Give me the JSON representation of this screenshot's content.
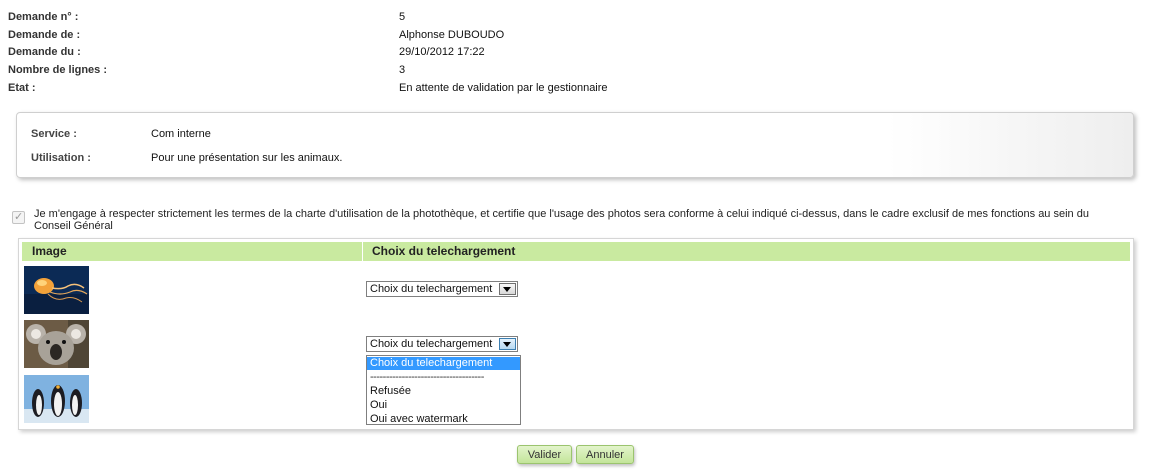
{
  "request": {
    "number_label": "Demande n° :",
    "number_value": "5",
    "from_label": "Demande de :",
    "from_value": "Alphonse DUBOUDO",
    "date_label": "Demande du :",
    "date_value": "29/10/2012 17:22",
    "lines_label": "Nombre de lignes :",
    "lines_value": "3",
    "state_label": "Etat :",
    "state_value": "En attente de validation par le gestionnaire"
  },
  "service_box": {
    "service_label": "Service :",
    "service_value": "Com interne",
    "usage_label": "Utilisation :",
    "usage_value": "Pour une présentation sur les animaux."
  },
  "engagement": {
    "checked": true,
    "text": "Je m'engage à respecter strictement les termes de la charte d'utilisation de la photothèque, et certifie que l'usage des photos sera conforme à celui indiqué ci-dessus, dans le cadre exclusif de mes fonctions au sein du Conseil Général"
  },
  "table": {
    "headers": [
      "Image",
      "Choix du telechargement"
    ],
    "header_color": "#c9eaa0",
    "rows": [
      {
        "image": "jellyfish",
        "select_value": "Choix du telechargement"
      },
      {
        "image": "koala",
        "select_value": "Choix du telechargement"
      },
      {
        "image": "penguins",
        "select_value": ""
      }
    ]
  },
  "dropdown": {
    "options": [
      "Choix du telechargement",
      "------------------------------------",
      "Refusée",
      "Oui",
      "Oui avec watermark"
    ],
    "highlighted": "Choix du telechargement",
    "highlight_color": "#3399ff"
  },
  "buttons": {
    "validate": "Valider",
    "cancel": "Annuler"
  }
}
